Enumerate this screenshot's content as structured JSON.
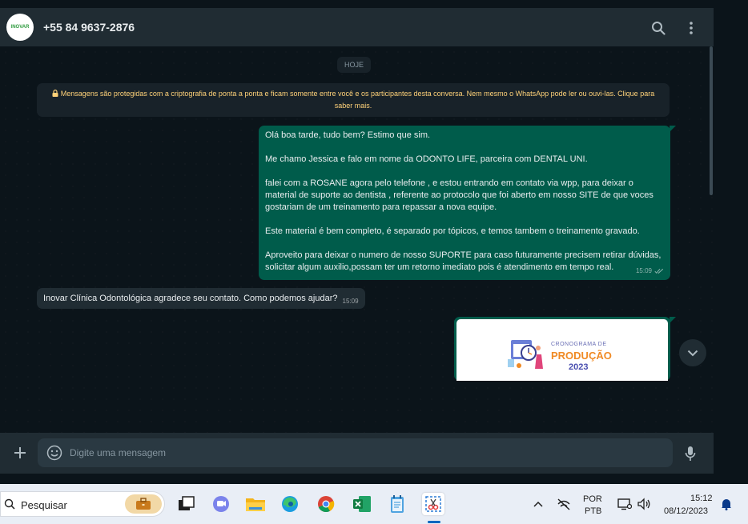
{
  "header": {
    "avatar_text": "INOVAR",
    "contact": "+55 84 9637-2876",
    "search_icon": "search-icon",
    "menu_icon": "kebab-menu-icon"
  },
  "chat": {
    "date_label": "HOJE",
    "encryption_notice": "Mensagens são protegidas com a criptografia de ponta a ponta e ficam somente entre você e os participantes desta conversa. Nem mesmo o WhatsApp pode ler ou ouvi-las. Clique para saber mais.",
    "outgoing": {
      "paragraphs": [
        "Olá boa tarde, tudo bem? Estimo que sim.",
        "Me chamo Jessica e falo em nome da ODONTO LIFE, parceira com DENTAL UNI.",
        "falei com a ROSANE agora pelo telefone , e estou entrando em contato via wpp, para deixar o material de suporte ao dentista , referente ao protocolo que foi aberto em nosso SITE de que voces gostariam de um treinamento para repassar a nova equipe.",
        "Este material é bem completo, é separado por tópicos, e temos tambem o treinamento gravado.",
        "Aproveito para deixar o numero de nosso SUPORTE para caso futuramente precisem retirar dúvidas, solicitar algum auxilio,possam ter um retorno imediato pois é atendimento em tempo real."
      ],
      "time": "15:09"
    },
    "incoming": {
      "text": "Inovar Clínica Odontológica agradece seu contato. Como podemos ajudar?",
      "time": "15:09"
    },
    "image_message": {
      "line1": "CRONOGRAMA DE",
      "line2": "PRODUÇÃO",
      "line3": "2023"
    }
  },
  "composer": {
    "placeholder": "Digite uma mensagem"
  },
  "taskbar": {
    "search_label": "Pesquisar",
    "lang_top": "POR",
    "lang_bottom": "PTB",
    "time": "15:12",
    "date": "08/12/2023"
  },
  "colors": {
    "outgoing_bubble": "#005c4b",
    "incoming_bubble": "#202c33",
    "chat_bg": "#0b141a",
    "notice_text": "#ffd279"
  }
}
